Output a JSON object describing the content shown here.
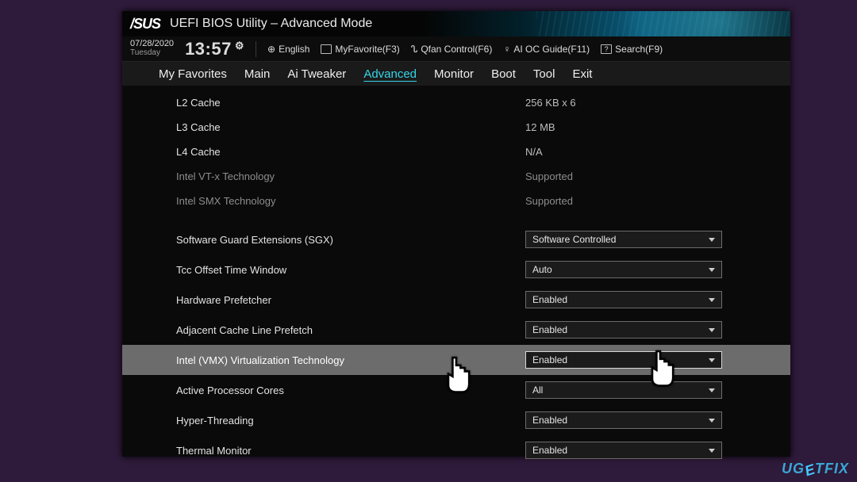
{
  "header": {
    "brand": "/SUS",
    "title": "UEFI BIOS Utility – Advanced Mode"
  },
  "datebar": {
    "date": "07/28/2020",
    "day": "Tuesday",
    "time": "13:57",
    "lang": "English",
    "fav": "MyFavorite(F3)",
    "qfan": "Qfan Control(F6)",
    "aioc": "AI OC Guide(F11)",
    "search": "Search(F9)"
  },
  "menu": {
    "items": [
      "My Favorites",
      "Main",
      "Ai Tweaker",
      "Advanced",
      "Monitor",
      "Boot",
      "Tool",
      "Exit"
    ],
    "active": 3
  },
  "info": [
    {
      "label": "L2 Cache",
      "value": "256 KB x 6"
    },
    {
      "label": "L3 Cache",
      "value": "12 MB"
    },
    {
      "label": "L4 Cache",
      "value": "N/A"
    },
    {
      "label": "Intel VT-x Technology",
      "value": "Supported",
      "dim": true
    },
    {
      "label": "Intel SMX Technology",
      "value": "Supported",
      "dim": true
    }
  ],
  "settings": [
    {
      "label": "Software Guard Extensions (SGX)",
      "value": "Software Controlled"
    },
    {
      "label": "Tcc Offset Time Window",
      "value": "Auto"
    },
    {
      "label": "Hardware Prefetcher",
      "value": "Enabled"
    },
    {
      "label": "Adjacent Cache Line Prefetch",
      "value": "Enabled"
    },
    {
      "label": "Intel (VMX) Virtualization Technology",
      "value": "Enabled",
      "highlight": true
    },
    {
      "label": "Active Processor Cores",
      "value": "All"
    },
    {
      "label": "Hyper-Threading",
      "value": "Enabled"
    },
    {
      "label": "Thermal Monitor",
      "value": "Enabled"
    }
  ],
  "watermark": {
    "pre": "UG",
    "e": "E",
    "post": "TFIX"
  }
}
